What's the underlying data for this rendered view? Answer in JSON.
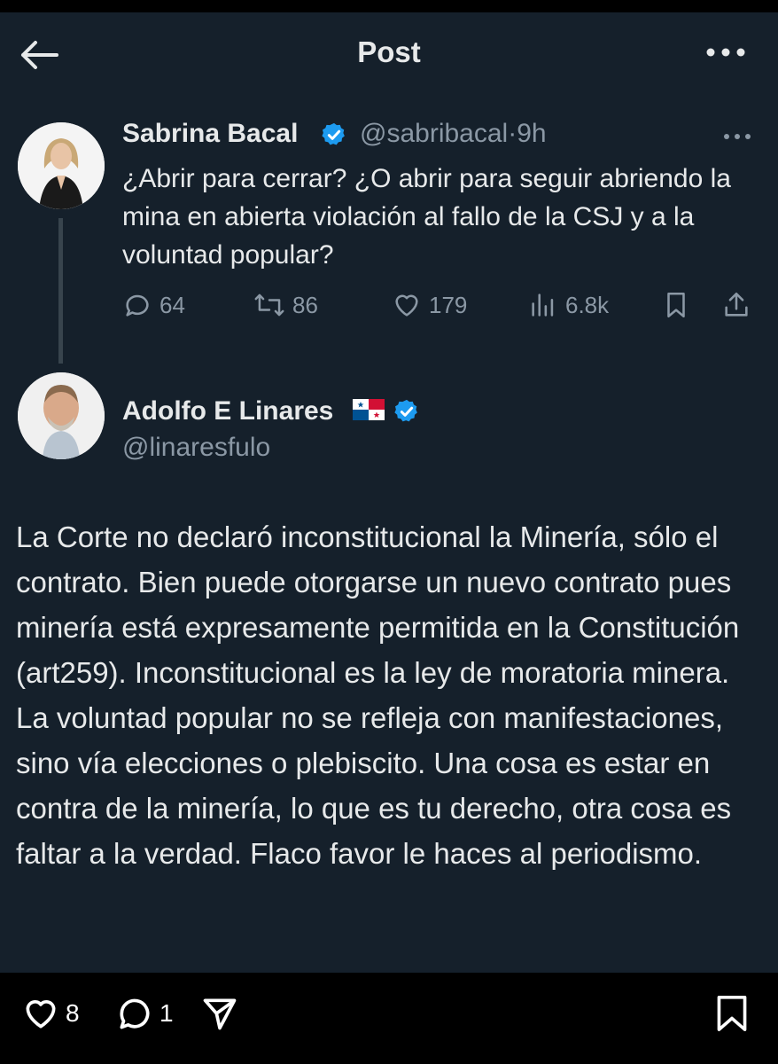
{
  "header": {
    "title": "Post"
  },
  "original_tweet": {
    "author_name": "Sabrina Bacal",
    "handle": "@sabribacal",
    "separator": "·",
    "time": "9h",
    "text": "¿Abrir para cerrar? ¿O abrir para seguir abriendo la mina en abierta violación al fallo de la CSJ y a la voluntad popular?",
    "stats": {
      "replies": "64",
      "reposts": "86",
      "likes": "179",
      "views": "6.8k"
    }
  },
  "reply_tweet": {
    "author_name": "Adolfo E Linares",
    "handle": "@linaresfulo",
    "text": "La Corte no declaró inconstitucional la Minería, sólo el contrato. Bien puede otorgarse un nuevo contrato pues minería está expresamente permitida en la Constitución (art259). Inconstitucional es la ley de moratoria minera. La voluntad popular no se refleja con manifestaciones, sino vía elecciones o plebiscito.  Una cosa es estar en contra de la minería, lo que es tu derecho, otra cosa es faltar a la verdad. Flaco favor le haces al periodismo."
  },
  "bottom_bar": {
    "likes": "8",
    "comments": "1"
  },
  "colors": {
    "background": "#15202b",
    "text": "#e7e9ea",
    "muted": "#8b98a5",
    "verified": "#1d9bf0"
  },
  "icons": [
    "back-arrow-icon",
    "more-icon",
    "verified-icon",
    "reply-icon",
    "repost-icon",
    "like-icon",
    "views-icon",
    "bookmark-icon",
    "share-icon",
    "panama-flag-icon",
    "heart-icon",
    "comment-icon",
    "send-icon",
    "save-icon"
  ]
}
